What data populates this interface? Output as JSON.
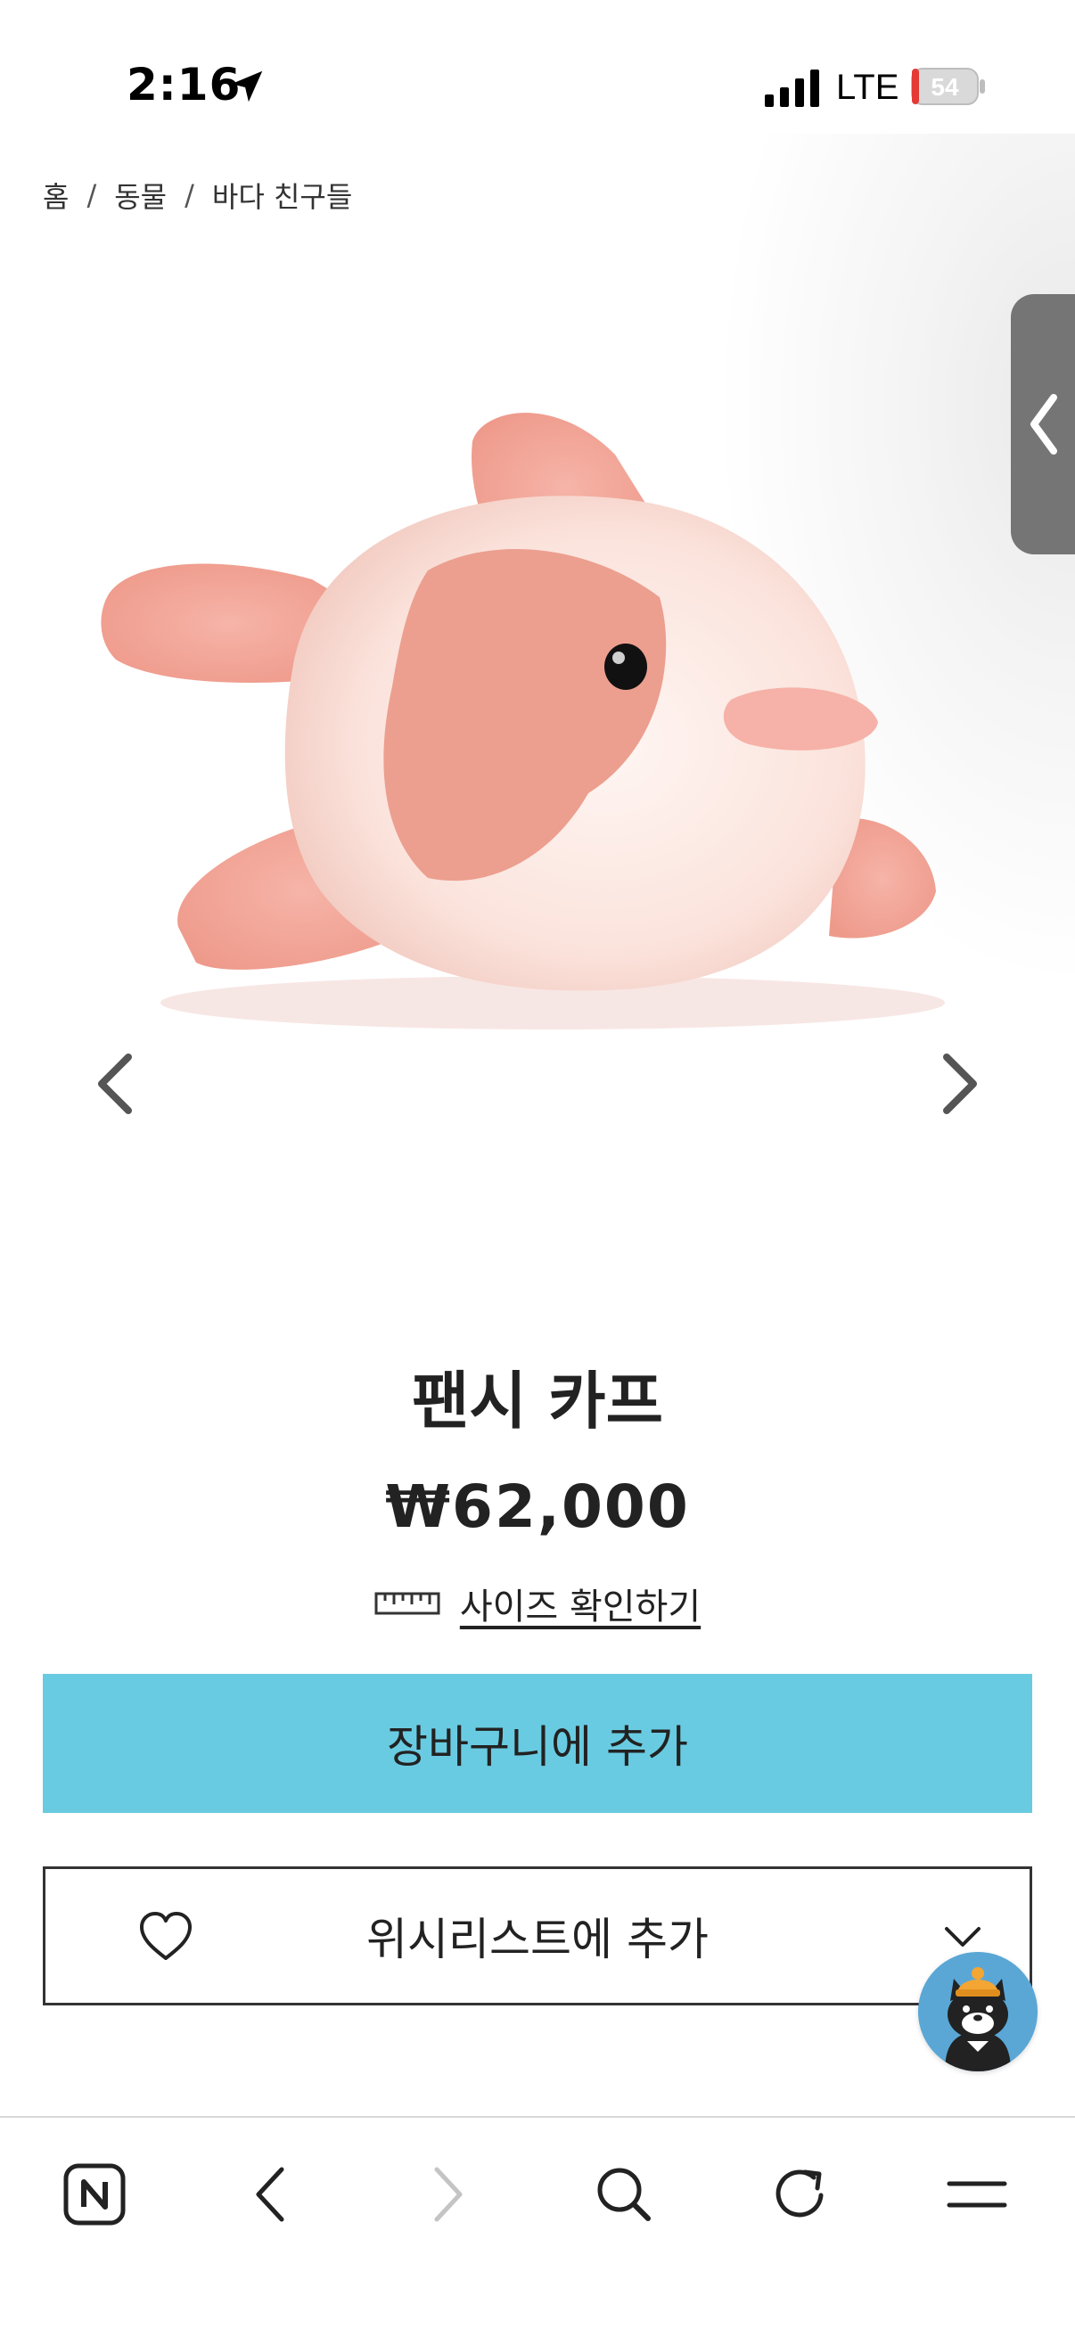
{
  "status_bar": {
    "time": "2:16",
    "carrier": "LTE",
    "battery": "54"
  },
  "breadcrumb": {
    "items": [
      "홈",
      "동물",
      "바다 친구들"
    ],
    "separator": "/"
  },
  "product": {
    "title": "팬시 카프",
    "price": "₩62,000",
    "size_link": "사이즈 확인하기",
    "add_to_cart": "장바구니에 추가",
    "add_to_wishlist": "위시리스트에 추가"
  },
  "colors": {
    "accent": "#69cbe1",
    "plush_pink": "#f3a79a",
    "plush_cream": "#fce9e4"
  },
  "icons": {
    "toolbar": [
      "naver-home-icon",
      "back-icon",
      "forward-icon",
      "search-icon",
      "reload-icon",
      "menu-icon"
    ]
  }
}
